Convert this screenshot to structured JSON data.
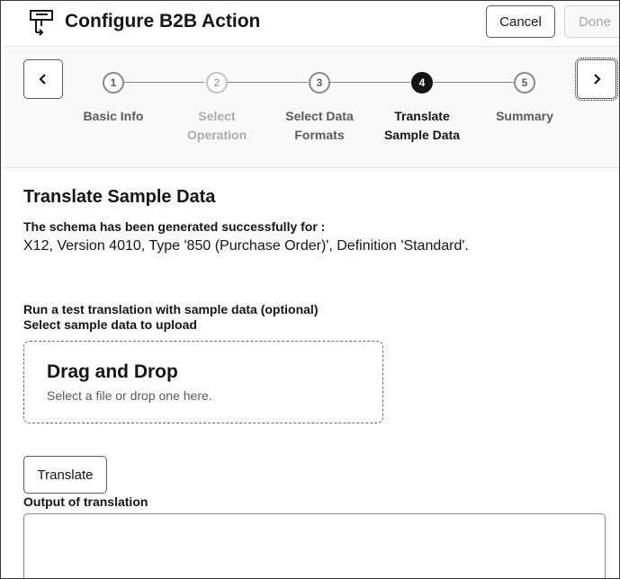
{
  "header": {
    "icon": "integration-flow-icon",
    "title": "Configure B2B Action",
    "cancel_label": "Cancel",
    "done_label": "Done"
  },
  "train": {
    "prev_icon": "chevron-left-icon",
    "next_icon": "chevron-right-icon",
    "steps": [
      {
        "number": "1",
        "label": "Basic Info",
        "state": "visited"
      },
      {
        "number": "2",
        "label": "Select Operation",
        "state": "disabled"
      },
      {
        "number": "3",
        "label": "Select Data Formats",
        "state": "visited"
      },
      {
        "number": "4",
        "label": "Translate Sample Data",
        "state": "current"
      },
      {
        "number": "5",
        "label": "Summary",
        "state": "visited"
      }
    ]
  },
  "main": {
    "section_title": "Translate Sample Data",
    "schema_label": "The schema has been generated successfully for :",
    "schema_value": "X12, Version 4010, Type '850 (Purchase Order)', Definition 'Standard'.",
    "run_label": "Run a test translation with sample data (optional)",
    "select_label": "Select sample data to upload",
    "dropzone": {
      "title": "Drag and Drop",
      "hint": "Select a file or drop one here."
    },
    "translate_label": "Translate",
    "output_label": "Output of translation",
    "output_value": ""
  },
  "colors": {
    "text": "#161513",
    "muted": "#5d5b58",
    "disabled": "#aeaca8",
    "train_bg": "#fbf9f8",
    "current_step": "#161513"
  }
}
